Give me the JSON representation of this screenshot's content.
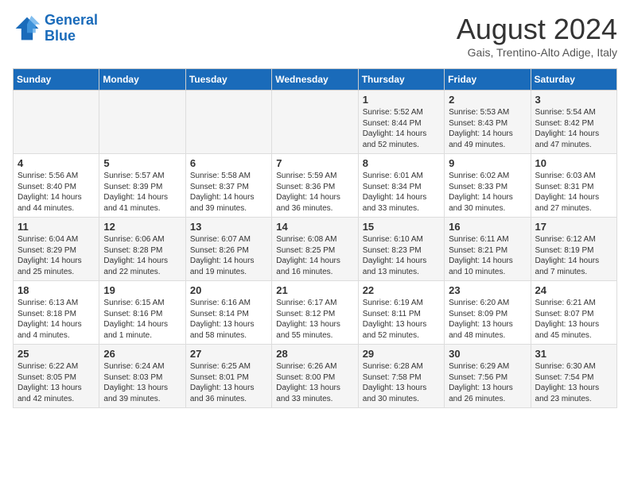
{
  "logo": {
    "line1": "General",
    "line2": "Blue"
  },
  "title": "August 2024",
  "subtitle": "Gais, Trentino-Alto Adige, Italy",
  "days_of_week": [
    "Sunday",
    "Monday",
    "Tuesday",
    "Wednesday",
    "Thursday",
    "Friday",
    "Saturday"
  ],
  "weeks": [
    [
      {
        "num": "",
        "info": ""
      },
      {
        "num": "",
        "info": ""
      },
      {
        "num": "",
        "info": ""
      },
      {
        "num": "",
        "info": ""
      },
      {
        "num": "1",
        "info": "Sunrise: 5:52 AM\nSunset: 8:44 PM\nDaylight: 14 hours and 52 minutes."
      },
      {
        "num": "2",
        "info": "Sunrise: 5:53 AM\nSunset: 8:43 PM\nDaylight: 14 hours and 49 minutes."
      },
      {
        "num": "3",
        "info": "Sunrise: 5:54 AM\nSunset: 8:42 PM\nDaylight: 14 hours and 47 minutes."
      }
    ],
    [
      {
        "num": "4",
        "info": "Sunrise: 5:56 AM\nSunset: 8:40 PM\nDaylight: 14 hours and 44 minutes."
      },
      {
        "num": "5",
        "info": "Sunrise: 5:57 AM\nSunset: 8:39 PM\nDaylight: 14 hours and 41 minutes."
      },
      {
        "num": "6",
        "info": "Sunrise: 5:58 AM\nSunset: 8:37 PM\nDaylight: 14 hours and 39 minutes."
      },
      {
        "num": "7",
        "info": "Sunrise: 5:59 AM\nSunset: 8:36 PM\nDaylight: 14 hours and 36 minutes."
      },
      {
        "num": "8",
        "info": "Sunrise: 6:01 AM\nSunset: 8:34 PM\nDaylight: 14 hours and 33 minutes."
      },
      {
        "num": "9",
        "info": "Sunrise: 6:02 AM\nSunset: 8:33 PM\nDaylight: 14 hours and 30 minutes."
      },
      {
        "num": "10",
        "info": "Sunrise: 6:03 AM\nSunset: 8:31 PM\nDaylight: 14 hours and 27 minutes."
      }
    ],
    [
      {
        "num": "11",
        "info": "Sunrise: 6:04 AM\nSunset: 8:29 PM\nDaylight: 14 hours and 25 minutes."
      },
      {
        "num": "12",
        "info": "Sunrise: 6:06 AM\nSunset: 8:28 PM\nDaylight: 14 hours and 22 minutes."
      },
      {
        "num": "13",
        "info": "Sunrise: 6:07 AM\nSunset: 8:26 PM\nDaylight: 14 hours and 19 minutes."
      },
      {
        "num": "14",
        "info": "Sunrise: 6:08 AM\nSunset: 8:25 PM\nDaylight: 14 hours and 16 minutes."
      },
      {
        "num": "15",
        "info": "Sunrise: 6:10 AM\nSunset: 8:23 PM\nDaylight: 14 hours and 13 minutes."
      },
      {
        "num": "16",
        "info": "Sunrise: 6:11 AM\nSunset: 8:21 PM\nDaylight: 14 hours and 10 minutes."
      },
      {
        "num": "17",
        "info": "Sunrise: 6:12 AM\nSunset: 8:19 PM\nDaylight: 14 hours and 7 minutes."
      }
    ],
    [
      {
        "num": "18",
        "info": "Sunrise: 6:13 AM\nSunset: 8:18 PM\nDaylight: 14 hours and 4 minutes."
      },
      {
        "num": "19",
        "info": "Sunrise: 6:15 AM\nSunset: 8:16 PM\nDaylight: 14 hours and 1 minute."
      },
      {
        "num": "20",
        "info": "Sunrise: 6:16 AM\nSunset: 8:14 PM\nDaylight: 13 hours and 58 minutes."
      },
      {
        "num": "21",
        "info": "Sunrise: 6:17 AM\nSunset: 8:12 PM\nDaylight: 13 hours and 55 minutes."
      },
      {
        "num": "22",
        "info": "Sunrise: 6:19 AM\nSunset: 8:11 PM\nDaylight: 13 hours and 52 minutes."
      },
      {
        "num": "23",
        "info": "Sunrise: 6:20 AM\nSunset: 8:09 PM\nDaylight: 13 hours and 48 minutes."
      },
      {
        "num": "24",
        "info": "Sunrise: 6:21 AM\nSunset: 8:07 PM\nDaylight: 13 hours and 45 minutes."
      }
    ],
    [
      {
        "num": "25",
        "info": "Sunrise: 6:22 AM\nSunset: 8:05 PM\nDaylight: 13 hours and 42 minutes."
      },
      {
        "num": "26",
        "info": "Sunrise: 6:24 AM\nSunset: 8:03 PM\nDaylight: 13 hours and 39 minutes."
      },
      {
        "num": "27",
        "info": "Sunrise: 6:25 AM\nSunset: 8:01 PM\nDaylight: 13 hours and 36 minutes."
      },
      {
        "num": "28",
        "info": "Sunrise: 6:26 AM\nSunset: 8:00 PM\nDaylight: 13 hours and 33 minutes."
      },
      {
        "num": "29",
        "info": "Sunrise: 6:28 AM\nSunset: 7:58 PM\nDaylight: 13 hours and 30 minutes."
      },
      {
        "num": "30",
        "info": "Sunrise: 6:29 AM\nSunset: 7:56 PM\nDaylight: 13 hours and 26 minutes."
      },
      {
        "num": "31",
        "info": "Sunrise: 6:30 AM\nSunset: 7:54 PM\nDaylight: 13 hours and 23 minutes."
      }
    ]
  ]
}
